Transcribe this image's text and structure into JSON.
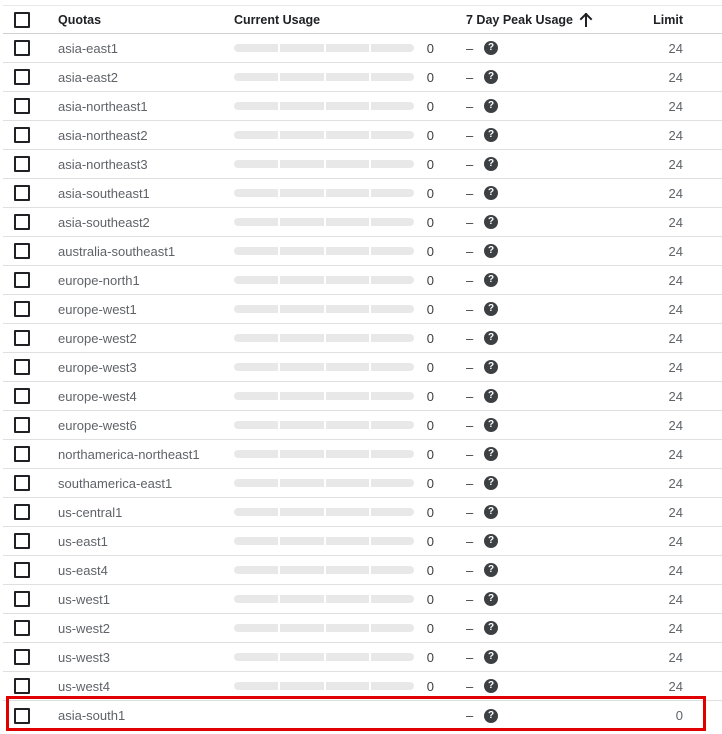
{
  "header": {
    "quotas": "Quotas",
    "current_usage": "Current Usage",
    "peak_usage": "7 Day Peak Usage",
    "limit": "Limit"
  },
  "rows": [
    {
      "name": "asia-east1",
      "current": "0",
      "usage_fraction": 0,
      "peak": "–",
      "limit": "24",
      "show_bar": true
    },
    {
      "name": "asia-east2",
      "current": "0",
      "usage_fraction": 0,
      "peak": "–",
      "limit": "24",
      "show_bar": true
    },
    {
      "name": "asia-northeast1",
      "current": "0",
      "usage_fraction": 0,
      "peak": "–",
      "limit": "24",
      "show_bar": true
    },
    {
      "name": "asia-northeast2",
      "current": "0",
      "usage_fraction": 0,
      "peak": "–",
      "limit": "24",
      "show_bar": true
    },
    {
      "name": "asia-northeast3",
      "current": "0",
      "usage_fraction": 0,
      "peak": "–",
      "limit": "24",
      "show_bar": true
    },
    {
      "name": "asia-southeast1",
      "current": "0",
      "usage_fraction": 0,
      "peak": "–",
      "limit": "24",
      "show_bar": true
    },
    {
      "name": "asia-southeast2",
      "current": "0",
      "usage_fraction": 0,
      "peak": "–",
      "limit": "24",
      "show_bar": true
    },
    {
      "name": "australia-southeast1",
      "current": "0",
      "usage_fraction": 0,
      "peak": "–",
      "limit": "24",
      "show_bar": true
    },
    {
      "name": "europe-north1",
      "current": "0",
      "usage_fraction": 0,
      "peak": "–",
      "limit": "24",
      "show_bar": true
    },
    {
      "name": "europe-west1",
      "current": "0",
      "usage_fraction": 0,
      "peak": "–",
      "limit": "24",
      "show_bar": true
    },
    {
      "name": "europe-west2",
      "current": "0",
      "usage_fraction": 0,
      "peak": "–",
      "limit": "24",
      "show_bar": true
    },
    {
      "name": "europe-west3",
      "current": "0",
      "usage_fraction": 0,
      "peak": "–",
      "limit": "24",
      "show_bar": true
    },
    {
      "name": "europe-west4",
      "current": "0",
      "usage_fraction": 0,
      "peak": "–",
      "limit": "24",
      "show_bar": true
    },
    {
      "name": "europe-west6",
      "current": "0",
      "usage_fraction": 0,
      "peak": "–",
      "limit": "24",
      "show_bar": true
    },
    {
      "name": "northamerica-northeast1",
      "current": "0",
      "usage_fraction": 0,
      "peak": "–",
      "limit": "24",
      "show_bar": true
    },
    {
      "name": "southamerica-east1",
      "current": "0",
      "usage_fraction": 0,
      "peak": "–",
      "limit": "24",
      "show_bar": true
    },
    {
      "name": "us-central1",
      "current": "0",
      "usage_fraction": 0,
      "peak": "–",
      "limit": "24",
      "show_bar": true
    },
    {
      "name": "us-east1",
      "current": "0",
      "usage_fraction": 0,
      "peak": "–",
      "limit": "24",
      "show_bar": true
    },
    {
      "name": "us-east4",
      "current": "0",
      "usage_fraction": 0,
      "peak": "–",
      "limit": "24",
      "show_bar": true
    },
    {
      "name": "us-west1",
      "current": "0",
      "usage_fraction": 0,
      "peak": "–",
      "limit": "24",
      "show_bar": true
    },
    {
      "name": "us-west2",
      "current": "0",
      "usage_fraction": 0,
      "peak": "–",
      "limit": "24",
      "show_bar": true
    },
    {
      "name": "us-west3",
      "current": "0",
      "usage_fraction": 0,
      "peak": "–",
      "limit": "24",
      "show_bar": true
    },
    {
      "name": "us-west4",
      "current": "0",
      "usage_fraction": 0,
      "peak": "–",
      "limit": "24",
      "show_bar": true
    },
    {
      "name": "asia-south1",
      "current": "",
      "usage_fraction": 0,
      "peak": "–",
      "limit": "0",
      "show_bar": false,
      "highlighted": true
    }
  ],
  "icons": {
    "sort": "arrow-upward-icon",
    "help": "help-circle-icon",
    "help_glyph": "?"
  },
  "colors": {
    "highlight_border": "#e00000",
    "bar_track": "#e8e8e8"
  }
}
